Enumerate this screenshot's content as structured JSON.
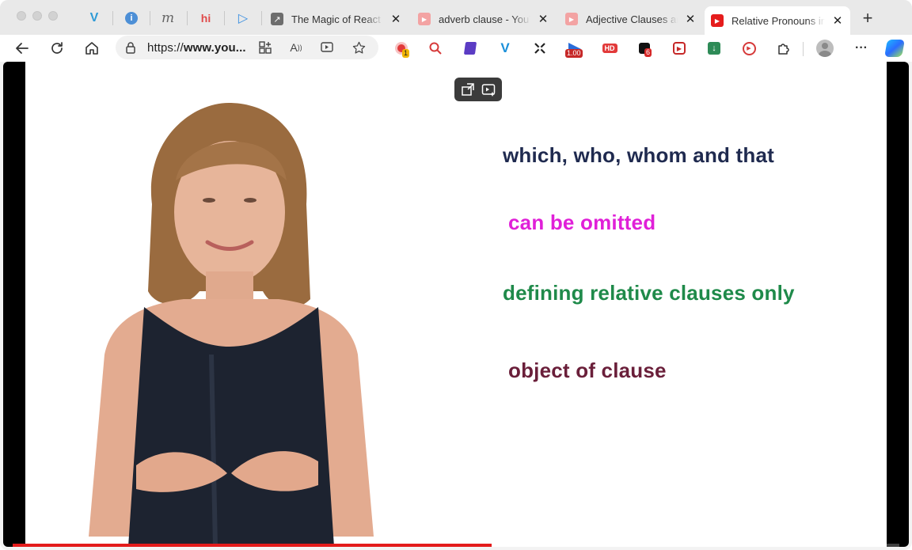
{
  "browser": {
    "pinned_tabs": [
      {
        "icon": "vimeo-v-icon"
      },
      {
        "icon": "info-icon"
      },
      {
        "icon": "m-icon"
      },
      {
        "icon": "hi-icon"
      },
      {
        "icon": "d-icon"
      }
    ],
    "tabs": [
      {
        "title": "The Magic of React - ",
        "favicon": "link-arrow-icon",
        "active": false
      },
      {
        "title": "adverb clause - YouT",
        "favicon": "youtube-icon",
        "active": false
      },
      {
        "title": "Adjective Clauses an",
        "favicon": "youtube-icon",
        "active": false
      },
      {
        "title": "Relative Pronouns in",
        "favicon": "youtube-icon",
        "active": true
      }
    ],
    "url_prefix": "https://",
    "url_domain": "www.you...",
    "extension_badges": {
      "record": "1",
      "speed": "1.00",
      "hd": "HD",
      "counter": "6"
    }
  },
  "video": {
    "lines": [
      {
        "text": "which, who, whom and that",
        "color": "#1f2a4f"
      },
      {
        "text": "can be omitted",
        "color": "#e020d8"
      },
      {
        "text": "defining relative clauses only",
        "color": "#1f8a4a"
      },
      {
        "text": "object of clause",
        "color": "#6a1f3a"
      }
    ],
    "progress_fraction": 0.54,
    "accent": "#e31b1b"
  }
}
